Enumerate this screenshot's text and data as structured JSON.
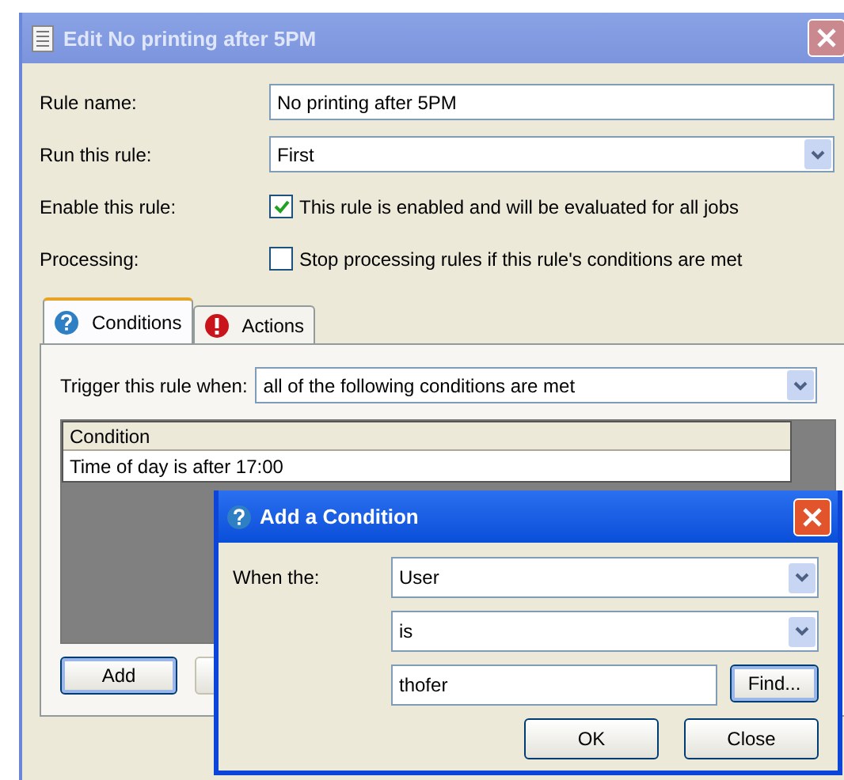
{
  "window": {
    "title": "Edit No printing after 5PM"
  },
  "fields": [
    {
      "kind": "text",
      "label": "Rule name:",
      "value": "No printing after 5PM"
    },
    {
      "kind": "select",
      "label": "Run this rule:",
      "value": "First"
    },
    {
      "kind": "checkbox",
      "label": "Enable this rule:",
      "text": "This rule is enabled and will be evaluated for all jobs",
      "checked": true
    },
    {
      "kind": "checkbox",
      "label": "Processing:",
      "text": "Stop processing rules if this rule's conditions are met",
      "checked": false
    }
  ],
  "tabs": [
    {
      "label": "Conditions",
      "kind": "question",
      "selected": true
    },
    {
      "label": "Actions",
      "kind": "alert",
      "selected": false
    }
  ],
  "trigger": {
    "label": "Trigger this rule when:",
    "value": "all of the following conditions are met"
  },
  "table": {
    "columns": [
      "Condition"
    ],
    "rows": [
      [
        "Time of day is after 17:00"
      ]
    ]
  },
  "buttons": [
    "Add"
  ],
  "dialog": {
    "title": "Add a Condition",
    "label": "When the:",
    "field_select": "User",
    "operator_select": "is",
    "value": "thofer",
    "find_button": "Find...",
    "buttons": [
      "OK",
      "Close"
    ]
  }
}
